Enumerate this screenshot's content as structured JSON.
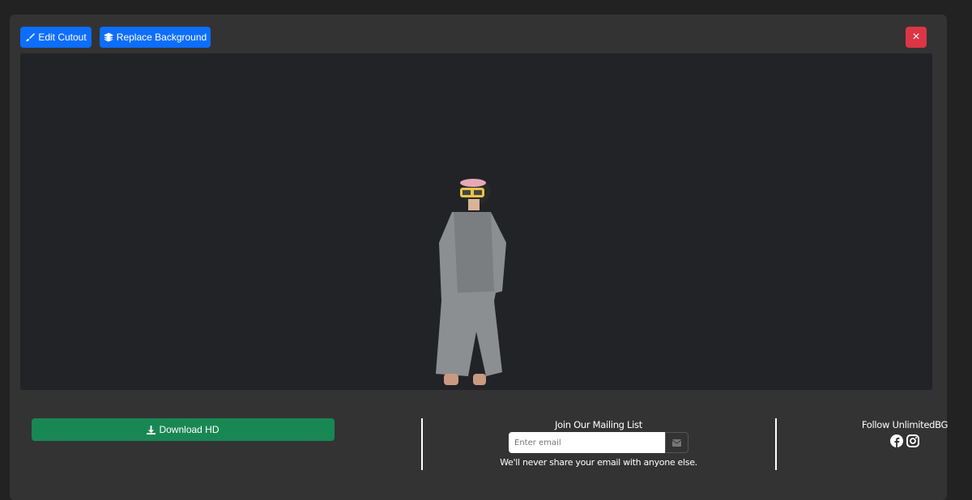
{
  "toolbar": {
    "edit_cutout": "Edit Cutout",
    "replace_background": "Replace Background",
    "close": "×"
  },
  "download": {
    "label": "Download HD"
  },
  "mailing": {
    "title": "Join Our Mailing List",
    "placeholder": "Enter email",
    "note": "We'll never share your email with anyone else."
  },
  "social": {
    "title": "Follow UnlimitedBG",
    "icons": [
      "facebook-icon",
      "instagram-icon"
    ]
  },
  "colors": {
    "primary": "#0d6efd",
    "success": "#198754",
    "danger": "#dc3545"
  }
}
